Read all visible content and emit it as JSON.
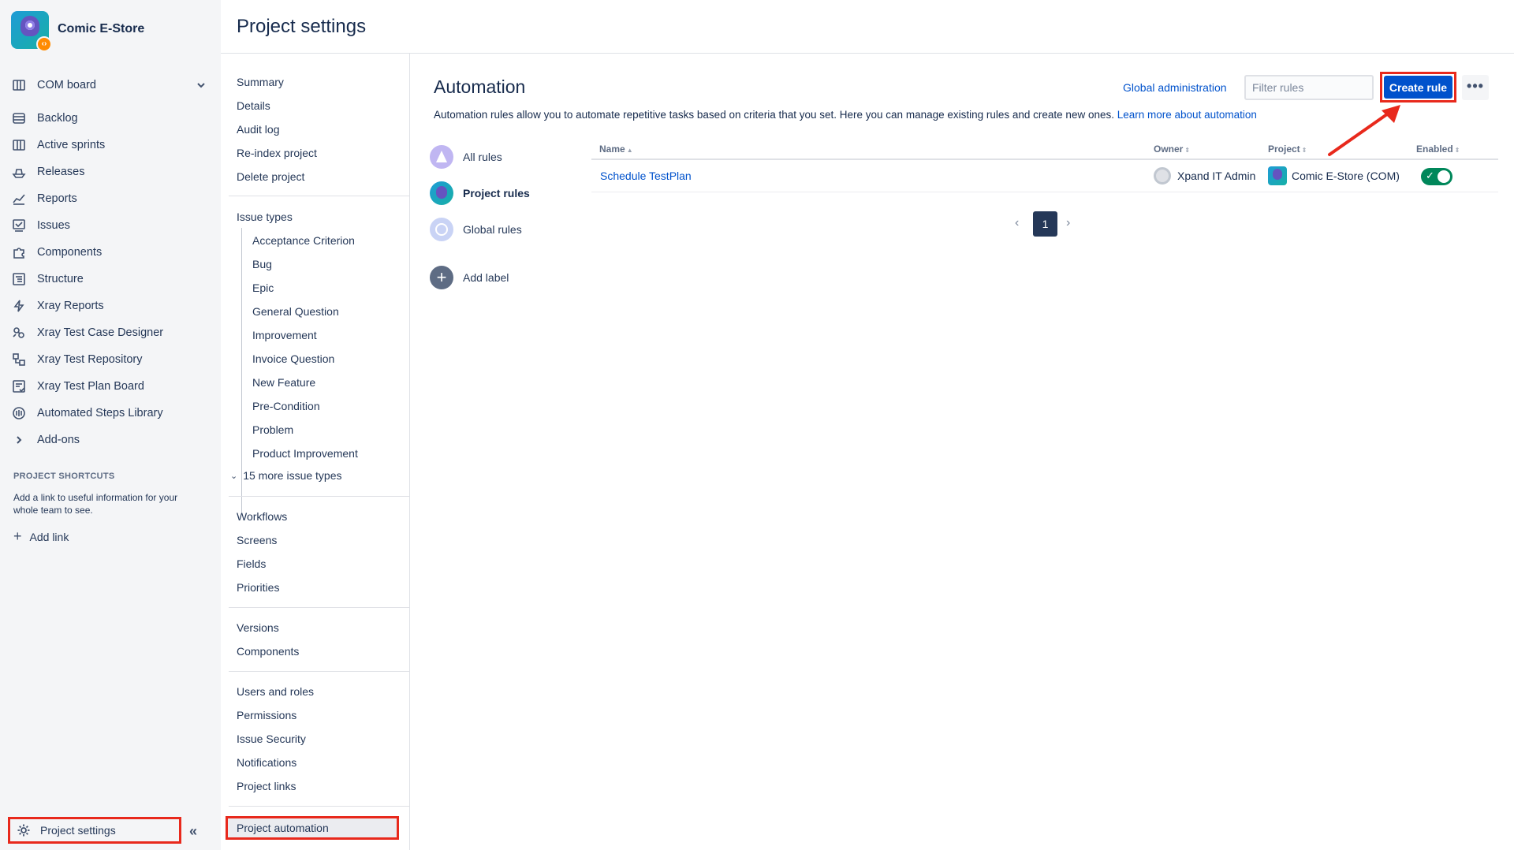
{
  "project": {
    "name": "Comic E-Store"
  },
  "sidebar": {
    "board": "COM board",
    "items": [
      {
        "label": "Backlog",
        "icon": "backlog-icon"
      },
      {
        "label": "Active sprints",
        "icon": "board-icon"
      },
      {
        "label": "Releases",
        "icon": "ship-icon"
      },
      {
        "label": "Reports",
        "icon": "chart-icon"
      },
      {
        "label": "Issues",
        "icon": "issues-icon"
      },
      {
        "label": "Components",
        "icon": "puzzle-icon"
      },
      {
        "label": "Structure",
        "icon": "structure-icon"
      },
      {
        "label": "Xray Reports",
        "icon": "bolt-icon"
      },
      {
        "label": "Xray Test Case Designer",
        "icon": "designer-icon"
      },
      {
        "label": "Xray Test Repository",
        "icon": "repository-icon"
      },
      {
        "label": "Xray Test Plan Board",
        "icon": "plan-board-icon"
      },
      {
        "label": "Automated Steps Library",
        "icon": "library-icon"
      },
      {
        "label": "Add-ons",
        "icon": "chevron-right-icon"
      }
    ],
    "shortcuts_heading": "PROJECT SHORTCUTS",
    "shortcuts_text": "Add a link to useful information for your whole team to see.",
    "add_link": "Add link",
    "project_settings": "Project settings",
    "collapse": "«"
  },
  "header": {
    "title": "Project settings"
  },
  "settings_nav": {
    "group1": [
      "Summary",
      "Details",
      "Audit log",
      "Re-index project",
      "Delete project"
    ],
    "issue_types_heading": "Issue types",
    "issue_types": [
      "Acceptance Criterion",
      "Bug",
      "Epic",
      "General Question",
      "Improvement",
      "Invoice Question",
      "New Feature",
      "Pre-Condition",
      "Problem",
      "Product Improvement"
    ],
    "more_types": "15 more issue types",
    "group3": [
      "Workflows",
      "Screens",
      "Fields",
      "Priorities"
    ],
    "group4": [
      "Versions",
      "Components"
    ],
    "group5": [
      "Users and roles",
      "Permissions",
      "Issue Security",
      "Notifications",
      "Project links"
    ],
    "active": "Project automation"
  },
  "automation": {
    "title": "Automation",
    "global_admin": "Global administration",
    "filter_placeholder": "Filter rules",
    "create_rule": "Create rule",
    "more": "•••",
    "description": "Automation rules allow you to automate repetitive tasks based on criteria that you set. Here you can manage existing rules and create new ones.",
    "learn_more": "Learn more about automation",
    "rule_nav": [
      {
        "label": "All rules"
      },
      {
        "label": "Project rules"
      },
      {
        "label": "Global rules"
      },
      {
        "label": "Add label"
      }
    ],
    "table": {
      "headers": {
        "name": "Name",
        "owner": "Owner",
        "project": "Project",
        "enabled": "Enabled"
      },
      "rows": [
        {
          "name": "Schedule TestPlan",
          "owner": "Xpand IT Admin",
          "project": "Comic E-Store (COM)",
          "enabled": true
        }
      ]
    },
    "pagination": {
      "current": "1",
      "prev": "‹",
      "next": "›"
    }
  }
}
